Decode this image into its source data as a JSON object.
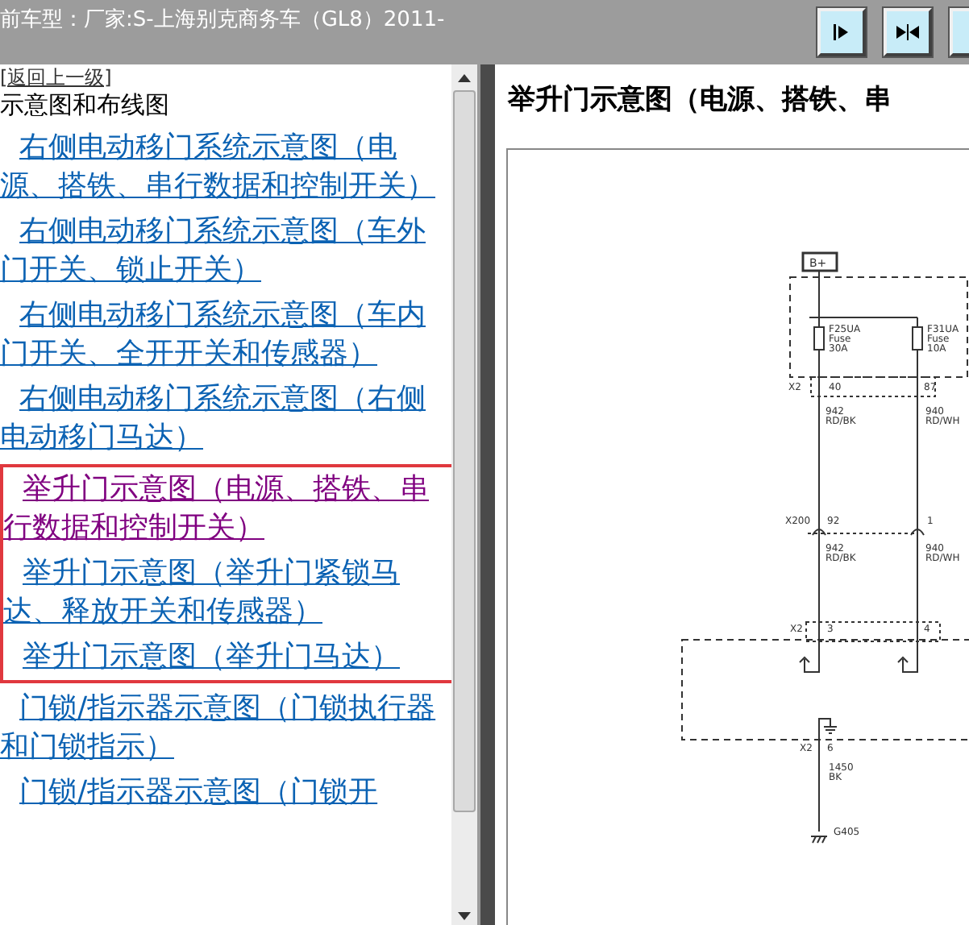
{
  "header": {
    "title": "前车型：厂家:S-上海别克商务车（GL8）2011-",
    "buttons": [
      {
        "kind": "right"
      },
      {
        "kind": "both"
      },
      {
        "kind": "edge"
      }
    ]
  },
  "sidebar": {
    "back_link": "[返回上一级]",
    "heading": "示意图和布线图",
    "items": [
      {
        "label": "右侧电动移门系统示意图（电源、搭铁、串行数据和控制开关）",
        "visited": false,
        "highlighted": false
      },
      {
        "label": "右侧电动移门系统示意图（车外门开关、锁止开关）",
        "visited": false,
        "highlighted": false
      },
      {
        "label": "右侧电动移门系统示意图（车内门开关、全开开关和传感器）",
        "visited": false,
        "highlighted": false
      },
      {
        "label": "右侧电动移门系统示意图（右侧电动移门马达）",
        "visited": false,
        "highlighted": false
      },
      {
        "label": "举升门示意图（电源、搭铁、串行数据和控制开关）",
        "visited": true,
        "highlighted": true
      },
      {
        "label": "举升门示意图（举升门紧锁马达、释放开关和传感器）",
        "visited": false,
        "highlighted": true
      },
      {
        "label": "举升门示意图（举升门马达）",
        "visited": false,
        "highlighted": true
      },
      {
        "label": "门锁/指示器示意图（门锁执行器和门锁指示）",
        "visited": false,
        "highlighted": false
      },
      {
        "label": "门锁/指示器示意图（门锁开",
        "visited": false,
        "highlighted": false
      }
    ]
  },
  "content": {
    "title": "举升门示意图（电源、搭铁、串",
    "diagram_labels": [
      "B+",
      "F25UA",
      "Fuse",
      "30A",
      "F31UA",
      "Fuse",
      "10A",
      "X2",
      "40",
      "87",
      "942",
      "RD/BK",
      "940",
      "RD/WH",
      "X200",
      "92",
      "1",
      "942",
      "RD/BK",
      "940",
      "RD/WH",
      "X2",
      "3",
      "4",
      "X2",
      "6",
      "1450",
      "BK",
      "G405"
    ]
  }
}
